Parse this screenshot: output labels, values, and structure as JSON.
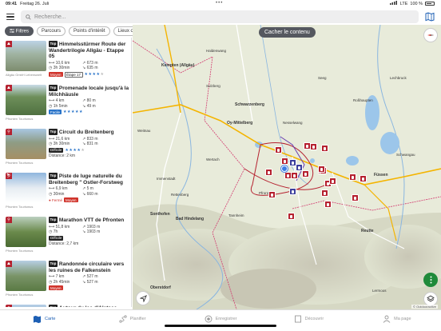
{
  "status": {
    "time": "09:41",
    "date": "Freitag 26. Juli",
    "network": "LTE",
    "battery": "100 %"
  },
  "search": {
    "placeholder": "Recherche..."
  },
  "filters": [
    "Filtres",
    "Parcours",
    "Points d'intérêt",
    "Lieux où s"
  ],
  "list": [
    {
      "title": "Himmelsstürmer Route der Wandertrilogie Allgäu - Etappe 05",
      "tag": "Top",
      "stats": [
        "10,6 km",
        "673 m",
        "3h 30min",
        "635 m"
      ],
      "difficulty": "Moyen",
      "difficulty_class": "moyen",
      "extra": "Étape 17",
      "rating": 4,
      "credit": "Allgäu GmbH Lebenswelt",
      "distance": "",
      "status": "",
      "icon": "hiking-icon",
      "img": "A"
    },
    {
      "title": "Promenade locale jusqu'à la Milchhäusle",
      "tag": "Top",
      "stats": [
        "4 km",
        "80 m",
        "1h 5min",
        "49 m"
      ],
      "difficulty": "Facile",
      "difficulty_class": "facile",
      "extra": "",
      "rating": 5,
      "credit": "Pfronten Tourismus",
      "distance": "",
      "status": "",
      "icon": "hiking-icon",
      "img": "B"
    },
    {
      "title": "Circuit du Breitenberg",
      "tag": "Top",
      "stats": [
        "21,6 km",
        "833 m",
        "3h 30min",
        "831 m"
      ],
      "difficulty": "Difficile",
      "difficulty_class": "difficile",
      "extra": "",
      "rating": 4,
      "credit": "Pfronten Tourismus",
      "distance": "Distance: 2 km",
      "status": "",
      "icon": "bike-icon",
      "img": "C"
    },
    {
      "title": "Piste de luge naturelle du Breitenberg \" Ostler-Forstweg",
      "tag": "Top",
      "stats": [
        "6,9 km",
        "5 m",
        "30min",
        "660 m"
      ],
      "difficulty": "Moyen",
      "difficulty_class": "moyen",
      "extra": "",
      "rating": 0,
      "credit": "Pfronten Tourismus",
      "distance": "",
      "status": "Fermé",
      "icon": "sled-icon",
      "img": "D"
    },
    {
      "title": "Marathon VTT de Pfronten",
      "tag": "Top",
      "stats": [
        "51,8 km",
        "1903 m",
        "7h",
        "1903 m"
      ],
      "difficulty": "Difficile",
      "difficulty_class": "difficile",
      "extra": "",
      "rating": 0,
      "credit": "Pfronten Tourismus",
      "distance": "Distance: 2,7 km",
      "status": "",
      "icon": "bike-icon",
      "img": "E"
    },
    {
      "title": "Randonnée circulaire vers les ruines de Falkenstein",
      "tag": "Top",
      "stats": [
        "7 km",
        "527 m",
        "2h 45min",
        "527 m"
      ],
      "difficulty": "Moyen",
      "difficulty_class": "moyen",
      "extra": "",
      "rating": 0,
      "credit": "Pfronten Tourismus",
      "distance": "",
      "status": "",
      "icon": "hiking-icon",
      "img": "F"
    },
    {
      "title": "Autour du lac d'Alatsee",
      "tag": "Top",
      "stats": [
        "",
        "",
        "",
        ""
      ],
      "difficulty": "",
      "difficulty_class": "",
      "extra": "",
      "rating": 0,
      "credit": "",
      "distance": "",
      "status": "",
      "icon": "hiking-icon",
      "img": "G"
    }
  ],
  "map": {
    "hide_button": "Cacher le contenu",
    "attribution": "© Outdooractive",
    "labels": {
      "kempten": "Kempten (Allgäu)",
      "schwarzenberg": "Schwarzenberg",
      "oy": "Oy-Mittelberg",
      "sonthofen": "Sonthofen",
      "badhindelang": "Bad Hindelang",
      "oberstdorf": "Oberstdorf",
      "reutte": "Reutte",
      "pfronten": "Pfronten",
      "fussen": "Füssen",
      "nesselwang": "Nesselwang",
      "wertach": "Wertach",
      "tannheim": "Tannheim",
      "schwangau": "Schwangau",
      "weitnau": "Weitnau",
      "immenstadt": "Immenstadt",
      "sulzberg": "Sulzberg",
      "haldenwang": "Haldenwang",
      "lechbruck": "Lechbruck",
      "rosshaupten": "Roßhaupten",
      "seeg": "Seeg",
      "rettenberg": "Rettenberg",
      "lermoos": "Lermoos"
    }
  },
  "tabs": [
    {
      "label": "Carte",
      "icon": "map-icon",
      "active": true
    },
    {
      "label": "Planifier",
      "icon": "route-icon",
      "active": false
    },
    {
      "label": "Enregistrer",
      "icon": "record-icon",
      "active": false
    },
    {
      "label": "Découvrir",
      "icon": "book-icon",
      "active": false
    },
    {
      "label": "Ma page",
      "icon": "person-icon",
      "active": false
    }
  ],
  "colors": {
    "accent": "#1d5fb4",
    "pin_red": "#b5212f",
    "pin_blue": "#3c3f9c",
    "difficulty_moyen": "#d0342c",
    "difficulty_facile": "#2a74c9"
  }
}
